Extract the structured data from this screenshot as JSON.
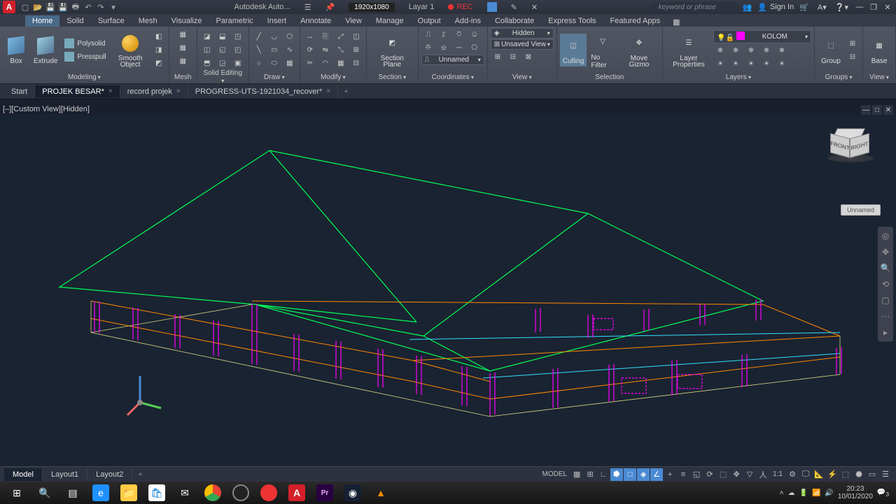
{
  "app": {
    "name": "Autodesk Auto...",
    "logo": "A"
  },
  "titlebar": {
    "resolution": "1920x1080",
    "layer_display": "Layar 1",
    "recording": "REC",
    "search_placeholder": "keyword or phrase",
    "signin": "Sign In"
  },
  "ribbon": {
    "tabs": [
      "Home",
      "Solid",
      "Surface",
      "Mesh",
      "Visualize",
      "Parametric",
      "Insert",
      "Annotate",
      "View",
      "Manage",
      "Output",
      "Add-ins",
      "Collaborate",
      "Express Tools",
      "Featured Apps"
    ],
    "active": "Home",
    "panels": {
      "modeling": {
        "title": "Modeling",
        "box": "Box",
        "extrude": "Extrude",
        "polysolid": "Polysolid",
        "presspull": "Presspull",
        "smooth": "Smooth Object"
      },
      "mesh": "Mesh",
      "solid_editing": "Solid Editing",
      "draw": "Draw",
      "modify": "Modify",
      "section": "Section",
      "section_plane": "Section Plane",
      "coordinates": "Coordinates",
      "view": "View",
      "hidden": "Hidden",
      "unsaved_view": "Unsaved View",
      "unnamed_ucs": "Unnamed",
      "selection": "Selection",
      "culling": "Culling",
      "no_filter": "No Filter",
      "move_gizmo": "Move Gizmo",
      "layers": "Layers",
      "layer_props": "Layer Properties",
      "current_layer": "KOLOM",
      "groups": "Groups",
      "group": "Group",
      "view_panel": "View",
      "base": "Base"
    }
  },
  "file_tabs": {
    "items": [
      {
        "label": "Start",
        "active": false,
        "closable": false
      },
      {
        "label": "PROJEK BESAR*",
        "active": true,
        "closable": true
      },
      {
        "label": "record projek",
        "active": false,
        "closable": true
      },
      {
        "label": "PROGRESS-UTS-1921034_recover*",
        "active": false,
        "closable": true
      }
    ]
  },
  "viewport": {
    "label": "[–][Custom View][Hidden]",
    "viewcube": {
      "front": "FRONT",
      "right": "RIGHT"
    },
    "unnamed_badge": "Unnamed"
  },
  "layout_tabs": [
    "Model",
    "Layout1",
    "Layout2"
  ],
  "layout_active": "Model",
  "status": {
    "model_label": "MODEL",
    "scale": "1:1"
  },
  "taskbar": {
    "time": "20:23",
    "date": "10/01/2020",
    "notif": "3"
  }
}
